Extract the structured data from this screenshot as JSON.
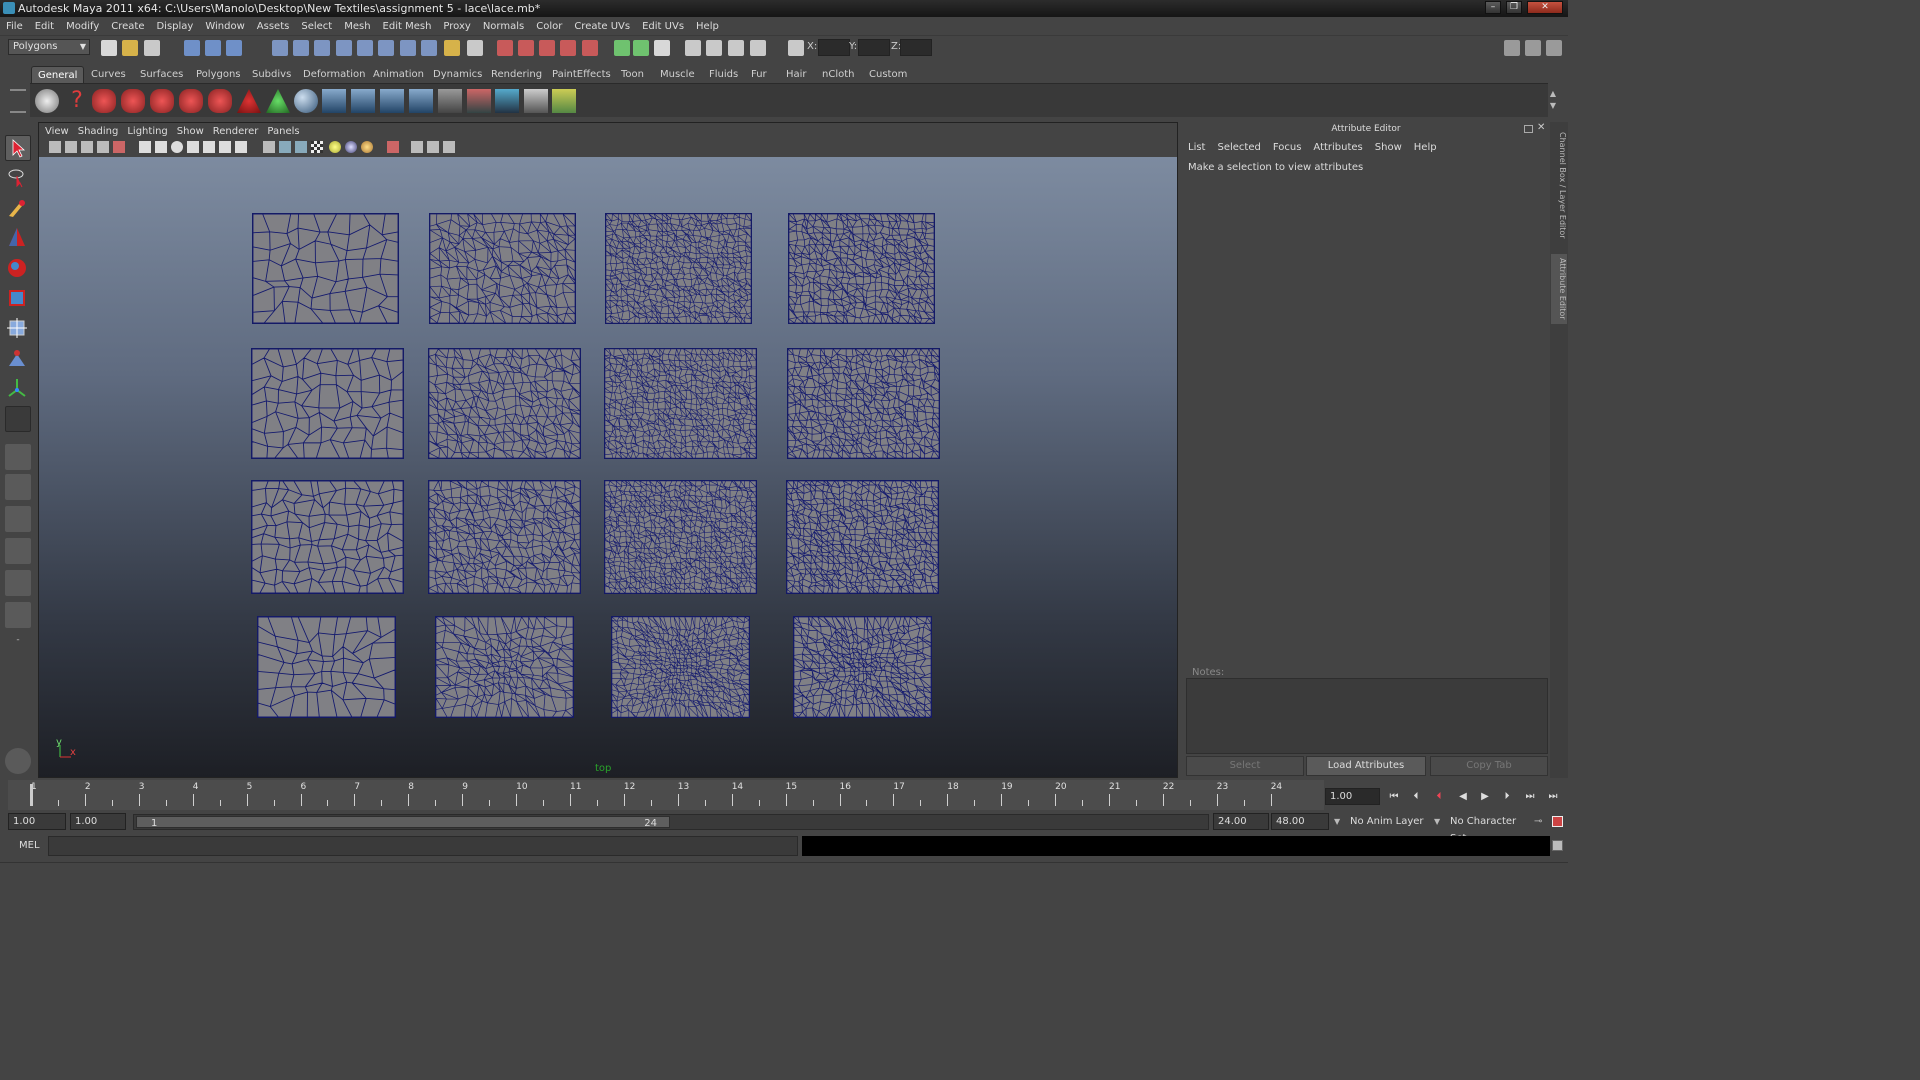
{
  "window": {
    "title": "Autodesk Maya 2011 x64: C:\\Users\\Manolo\\Desktop\\New Textiles\\assignment 5 - lace\\lace.mb*",
    "buttons": [
      "–",
      "❐",
      "✕"
    ]
  },
  "menubar": [
    "File",
    "Edit",
    "Modify",
    "Create",
    "Display",
    "Window",
    "Assets",
    "Select",
    "Mesh",
    "Edit Mesh",
    "Proxy",
    "Normals",
    "Color",
    "Create UVs",
    "Edit UVs",
    "Help"
  ],
  "statusline": {
    "mode": "Polygons",
    "x_label": "X:",
    "y_label": "Y:",
    "z_label": "Z:"
  },
  "shelf": {
    "tabs": [
      "General",
      "Curves",
      "Surfaces",
      "Polygons",
      "Subdivs",
      "Deformation",
      "Animation",
      "Dynamics",
      "Rendering",
      "PaintEffects",
      "Toon",
      "Muscle",
      "Fluids",
      "Fur",
      "Hair",
      "nCloth",
      "Custom"
    ],
    "active_tab": "General"
  },
  "viewport": {
    "menu": [
      "View",
      "Shading",
      "Lighting",
      "Show",
      "Renderer",
      "Panels"
    ],
    "camera_label": "top",
    "axis_y": "y",
    "axis_x": "x",
    "grid_rows": 4,
    "grid_cols": 4
  },
  "attribute_editor": {
    "title": "Attribute Editor",
    "menu": [
      "List",
      "Selected",
      "Focus",
      "Attributes",
      "Show",
      "Help"
    ],
    "message": "Make a selection to view attributes",
    "notes_label": "Notes:",
    "buttons": {
      "select": "Select",
      "load": "Load Attributes",
      "copy": "Copy Tab"
    },
    "side_tabs": [
      "Channel Box / Layer Editor",
      "Attribute Editor"
    ]
  },
  "timeline": {
    "frames": [
      1,
      2,
      3,
      4,
      5,
      6,
      7,
      8,
      9,
      10,
      11,
      12,
      13,
      14,
      15,
      16,
      17,
      18,
      19,
      20,
      21,
      22,
      23,
      24
    ],
    "current_frame": "1.00"
  },
  "range": {
    "start": "1.00",
    "anim_start": "1.00",
    "range_start": "1",
    "range_end": "24",
    "anim_end": "24.00",
    "end": "48.00",
    "anim_layer": "No Anim Layer",
    "char_set": "No Character Set"
  },
  "command": {
    "label": "MEL"
  },
  "colors": {
    "wire": "#141a6e",
    "mesh": "#808085",
    "accent": "#5a5a5a"
  }
}
